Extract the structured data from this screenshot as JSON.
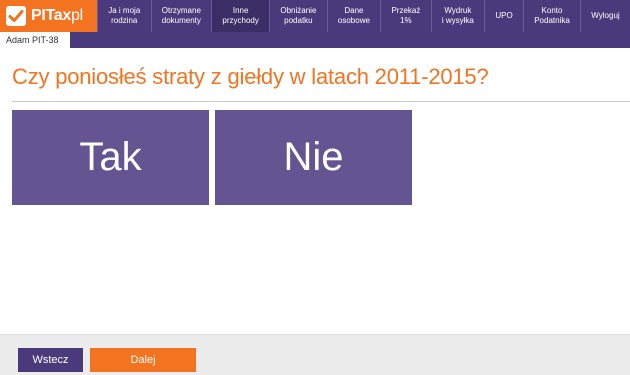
{
  "app": {
    "logo_text": "PITax",
    "logo_suffix": "pl"
  },
  "nav": {
    "items": [
      {
        "label": "Ja i moja\nrodzina"
      },
      {
        "label": "Otrzymane\ndokumenty"
      },
      {
        "label": "Inne\nprzychody"
      },
      {
        "label": "Obniżanie\npodatku"
      },
      {
        "label": "Dane\nosobowe"
      },
      {
        "label": "Przekaż\n1%"
      },
      {
        "label": "Wydruk\ni wysyłka"
      },
      {
        "label": "UPO"
      },
      {
        "label": "Konto\nPodatnika"
      },
      {
        "label": "Wyloguj"
      }
    ]
  },
  "subheader": {
    "tab_label": "Adam PIT-38"
  },
  "main": {
    "question": "Czy poniosłeś straty z giełdy w latach 2011-2015?",
    "answer_yes": "Tak",
    "answer_no": "Nie"
  },
  "footer": {
    "back_label": "Wstecz",
    "next_label": "Dalej"
  },
  "colors": {
    "brand_orange": "#f47320",
    "brand_purple": "#4b3a7b",
    "tile_purple": "#645592"
  }
}
